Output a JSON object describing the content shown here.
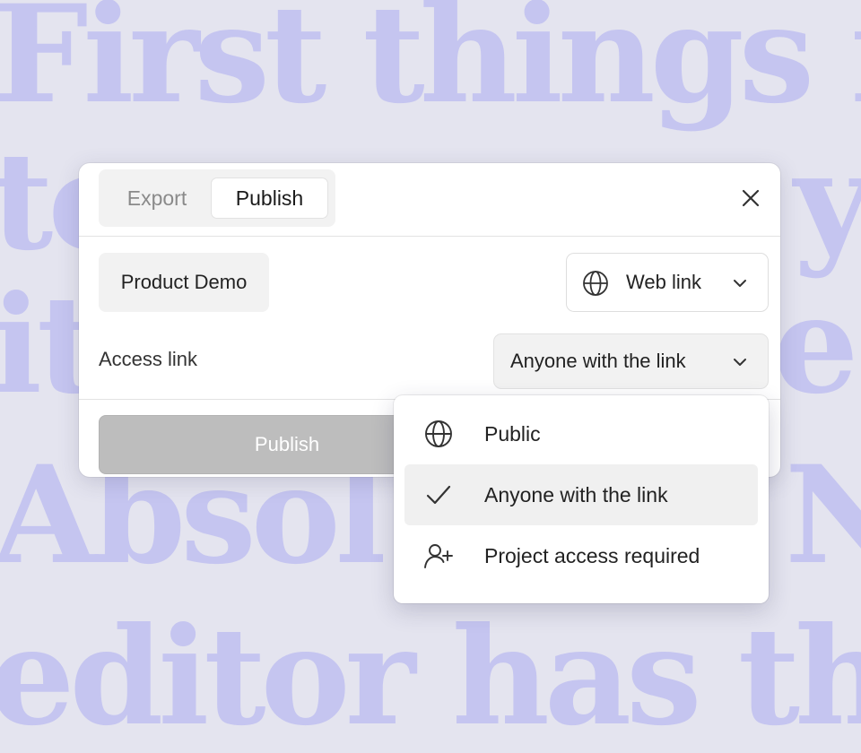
{
  "background": {
    "lines": [
      "First things fi",
      "to",
      "y",
      "it",
      "e",
      "Absol",
      "N",
      "editor has th"
    ]
  },
  "dialog": {
    "tabs": [
      {
        "label": "Export",
        "active": false
      },
      {
        "label": "Publish",
        "active": true
      }
    ],
    "close_icon": "close-icon",
    "project_name": "Product Demo",
    "link_type": {
      "label": "Web link",
      "icon": "globe-icon"
    },
    "access": {
      "label": "Access link",
      "selected": "Anyone with the link"
    },
    "publish_button": "Publish"
  },
  "dropdown": {
    "options": [
      {
        "label": "Public",
        "icon": "globe-icon",
        "selected": false
      },
      {
        "label": "Anyone with the link",
        "icon": "check-icon",
        "selected": true
      },
      {
        "label": "Project access required",
        "icon": "user-plus-icon",
        "selected": false
      }
    ]
  },
  "colors": {
    "background": "#e4e4ef",
    "background_text": "#c5c5f0",
    "publish_disabled": "#bdbdbd",
    "selected_row": "#f0f0f0"
  }
}
